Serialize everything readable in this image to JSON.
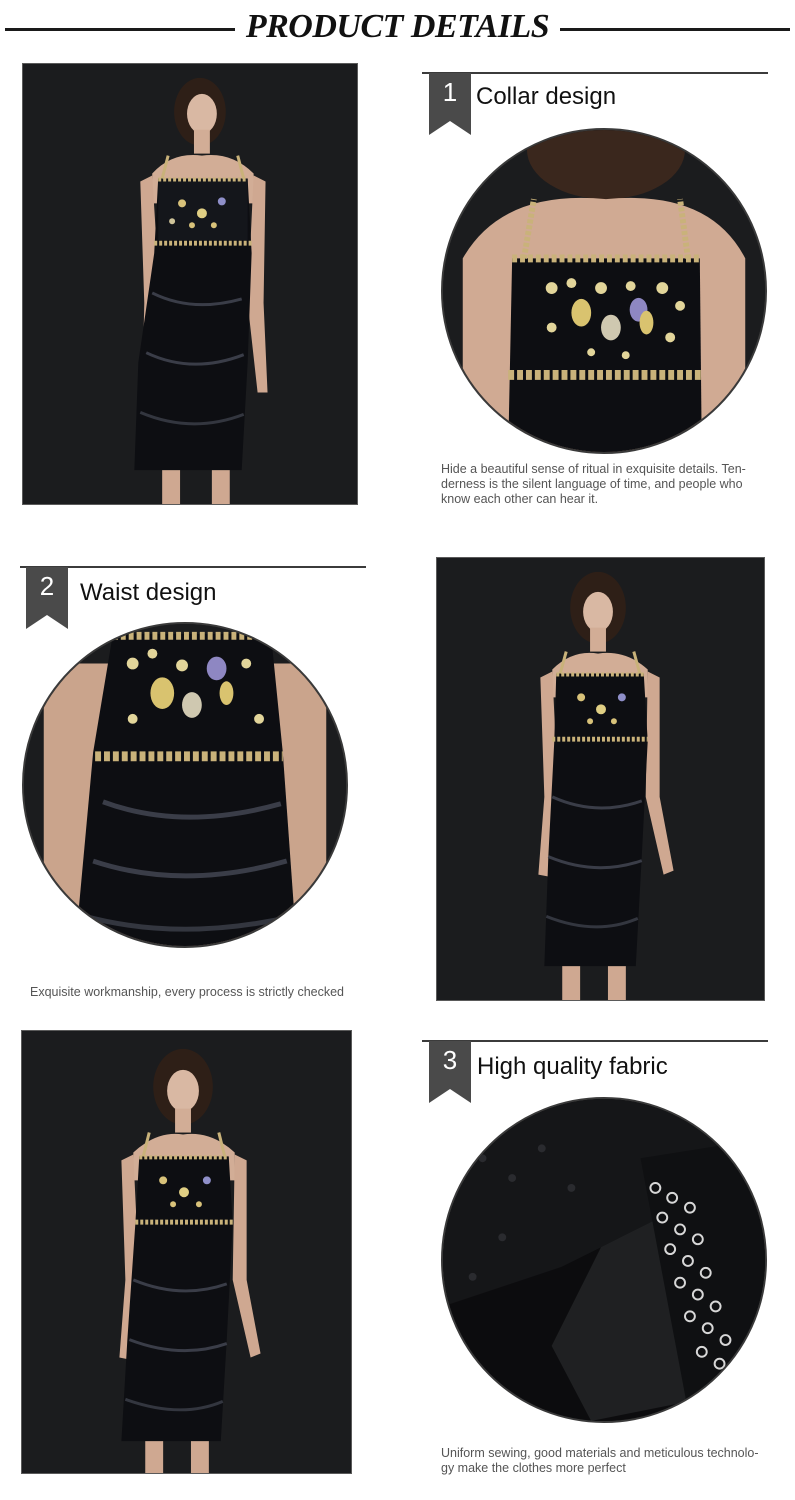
{
  "header": {
    "title": "PRODUCT DETAILS"
  },
  "sections": [
    {
      "number": "1",
      "title": "Collar design",
      "description_lines": [
        "Hide a beautiful sense of ritual in exquisite details. Ten-",
        "derness is the silent language of time, and people who",
        "know each other can hear it."
      ]
    },
    {
      "number": "2",
      "title": "Waist design",
      "description_lines": [
        "Exquisite workmanship, every process is strictly checked"
      ]
    },
    {
      "number": "3",
      "title": "High quality fabric",
      "description_lines": [
        "Uniform sewing, good materials and meticulous technolo-",
        "gy make the clothes more perfect"
      ]
    }
  ],
  "colors": {
    "accent": "#4a4a4a",
    "photo_background": "#1b1c1e",
    "dress": "#0d0e12",
    "gold_trim": "#c9b27a"
  }
}
